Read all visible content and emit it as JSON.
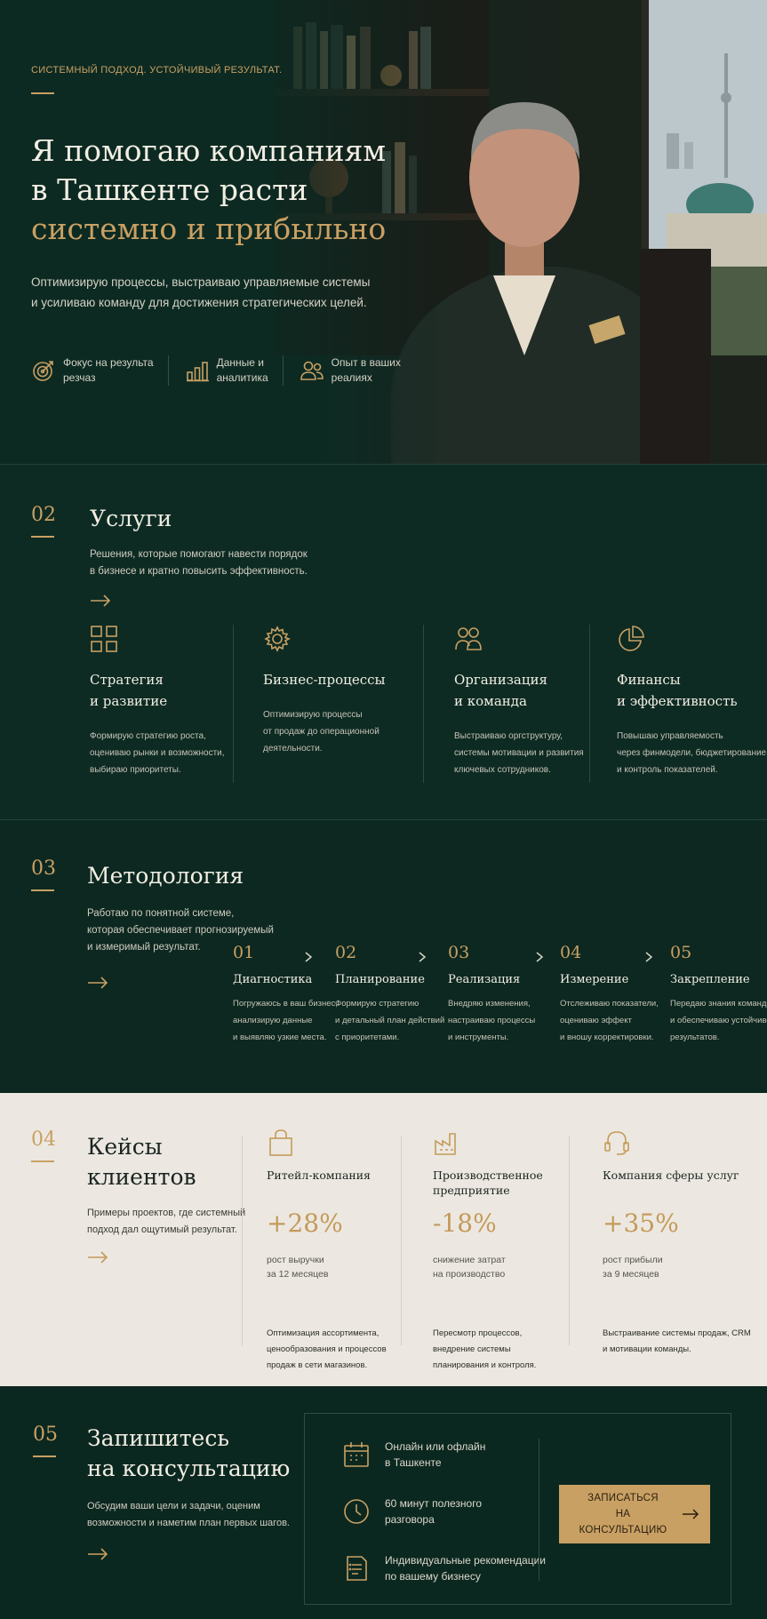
{
  "hero": {
    "tagline": "СИСТЕМНЫЙ ПОДХОД. УСТОЙЧИВЫЙ РЕЗУЛЬТАТ.",
    "title_line1": "Я помогаю компаниям",
    "title_line2": "в Ташкенте расти",
    "title_line3": "системно и прибыльно",
    "subtitle_line1": "Оптимизирую процессы, выстраиваю управляемые системы",
    "subtitle_line2": "и усиливаю команду для достижения стратегических целей.",
    "features": [
      {
        "icon": "target-icon",
        "line1": "Фокус на результа",
        "line2": "резчаз"
      },
      {
        "icon": "bar-chart-icon",
        "line1": "Данные и",
        "line2": "аналитика"
      },
      {
        "icon": "users-icon",
        "line1": "Опыт в ваших",
        "line2": "реалиях"
      }
    ]
  },
  "services": {
    "number": "02",
    "title": "Услуги",
    "subtitle_line1": "Решения, которые помогают навести порядок",
    "subtitle_line2": "в бизнесе и кратно повысить эффективность.",
    "items": [
      {
        "icon": "grid-icon",
        "title": "Стратегия\nи развитие",
        "text": "Формирую стратегию роста,\nоцениваю рынки и возможности,\nвыбираю приоритеты."
      },
      {
        "icon": "gear-icon",
        "title": "Бизнес-процессы",
        "text": "Оптимизирую процессы\nот продаж до операционной\nдеятельности."
      },
      {
        "icon": "team-icon",
        "title": "Организация\nи команда",
        "text": "Выстраиваю оргструктуру,\nсистемы мотивации и развития\nключевых сотрудников."
      },
      {
        "icon": "pie-chart-icon",
        "title": "Финансы\nи эффективность",
        "text": "Повышаю управляемость\nчерез финмодели, бюджетирование\nи контроль показателей."
      }
    ]
  },
  "method": {
    "number": "03",
    "title": "Методология",
    "subtitle_line1": "Работаю по понятной системе,",
    "subtitle_line2": "которая обеспечивает прогнозируемый",
    "subtitle_line3": "и измеримый результат.",
    "steps": [
      {
        "n": "01",
        "title": "Диагностика",
        "text": "Погружаюсь в ваш бизнес,\nанализирую данные\nи выявляю узкие места."
      },
      {
        "n": "02",
        "title": "Планирование",
        "text": "Формирую стратегию\nи детальный план действий\nс приоритетами."
      },
      {
        "n": "03",
        "title": "Реализация",
        "text": "Внедряю изменения,\nнастраиваю процессы\nи инструменты."
      },
      {
        "n": "04",
        "title": "Измерение",
        "text": "Отслеживаю показатели,\nоцениваю эффект\nи вношу корректировки."
      },
      {
        "n": "05",
        "title": "Закрепление",
        "text": "Передаю знания команде\nи обеспечиваю устойчивость\nрезультатов."
      }
    ]
  },
  "cases": {
    "number": "04",
    "title_line1": "Кейсы",
    "title_line2": "клиентов",
    "subtitle_line1": "Примеры проектов, где системный",
    "subtitle_line2": "подход дал ощутимый результат.",
    "items": [
      {
        "icon": "shopping-bag-icon",
        "title": "Ритейл-компания",
        "value": "+28%",
        "metric": "рост выручки\nза 12 месяцев",
        "text": "Оптимизация ассортимента,\nценообразования и процессов\nпродаж в сети магазинов."
      },
      {
        "icon": "factory-icon",
        "title": "Производственное\nпредприятие",
        "value": "-18%",
        "metric": "снижение затрат\nна производство",
        "text": "Пересмотр процессов,\nвнедрение системы\nпланирования и контроля."
      },
      {
        "icon": "headset-icon",
        "title": "Компания сферы услуг",
        "value": "+35%",
        "metric": "рост прибыли\nза 9 месяцев",
        "text": "Выстраивание системы продаж, CRM\nи мотивации команды."
      }
    ]
  },
  "contact": {
    "number": "05",
    "title_line1": "Запишитесь",
    "title_line2": "на консультацию",
    "subtitle_line1": "Обсудим ваши цели и задачи, оценим",
    "subtitle_line2": "возможности и наметим план первых шагов.",
    "items": [
      {
        "icon": "calendar-icon",
        "line1": "Онлайн или офлайн",
        "line2": "в Ташкенте"
      },
      {
        "icon": "clock-icon",
        "line1": "60 минут полезного",
        "line2": "разговора"
      },
      {
        "icon": "document-icon",
        "line1": "Индивидуальные рекомендации",
        "line2": "по вашему бизнесу"
      }
    ],
    "cta_line1": "ЗАПИСАТЬСЯ",
    "cta_line2": "НА КОНСУЛЬТАЦИЮ"
  },
  "colors": {
    "accent": "#c9a063",
    "dark_green": "#0c2a22",
    "light_bg": "#ece8e1"
  }
}
